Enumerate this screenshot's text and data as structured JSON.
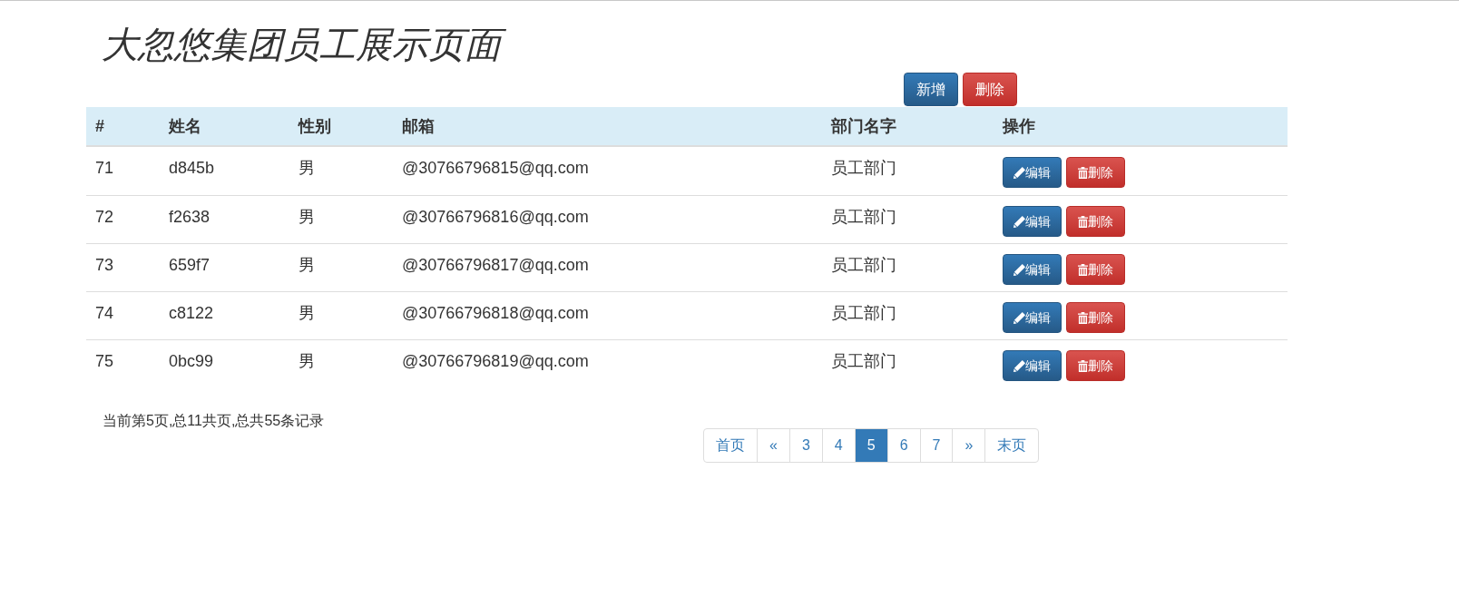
{
  "title": "大忽悠集团员工展示页面",
  "toolbar": {
    "buttons": [
      {
        "label": "新增",
        "kind": "primary"
      },
      {
        "label": "删除",
        "kind": "danger"
      }
    ]
  },
  "table": {
    "columns": [
      "#",
      "姓名",
      "性别",
      "邮箱",
      "部门名字",
      "操作"
    ],
    "rows": [
      {
        "cells": [
          "71",
          "d845b",
          "男",
          "@30766796815@qq.com",
          "员工部门"
        ],
        "actions": [
          {
            "label": "编辑",
            "kind": "edit"
          },
          {
            "label": "删除",
            "kind": "delete"
          }
        ]
      },
      {
        "cells": [
          "72",
          "f2638",
          "男",
          "@30766796816@qq.com",
          "员工部门"
        ],
        "actions": [
          {
            "label": "编辑",
            "kind": "edit"
          },
          {
            "label": "删除",
            "kind": "delete"
          }
        ]
      },
      {
        "cells": [
          "73",
          "659f7",
          "男",
          "@30766796817@qq.com",
          "员工部门"
        ],
        "actions": [
          {
            "label": "编辑",
            "kind": "edit"
          },
          {
            "label": "删除",
            "kind": "delete"
          }
        ]
      },
      {
        "cells": [
          "74",
          "c8122",
          "男",
          "@30766796818@qq.com",
          "员工部门"
        ],
        "actions": [
          {
            "label": "编辑",
            "kind": "edit"
          },
          {
            "label": "删除",
            "kind": "delete"
          }
        ]
      },
      {
        "cells": [
          "75",
          "0bc99",
          "男",
          "@30766796819@qq.com",
          "员工部门"
        ],
        "actions": [
          {
            "label": "编辑",
            "kind": "edit"
          },
          {
            "label": "删除",
            "kind": "delete"
          }
        ]
      }
    ]
  },
  "pagination": {
    "info": "当前第5页,总11共页,总共55条记录",
    "pages": [
      {
        "label": "首页",
        "selected": false
      },
      {
        "label": "«",
        "selected": false
      },
      {
        "label": "3",
        "selected": false
      },
      {
        "label": "4",
        "selected": false
      },
      {
        "label": "5",
        "selected": true
      },
      {
        "label": "6",
        "selected": false
      },
      {
        "label": "7",
        "selected": false
      },
      {
        "label": "»",
        "selected": false
      },
      {
        "label": "末页",
        "selected": false
      }
    ]
  }
}
